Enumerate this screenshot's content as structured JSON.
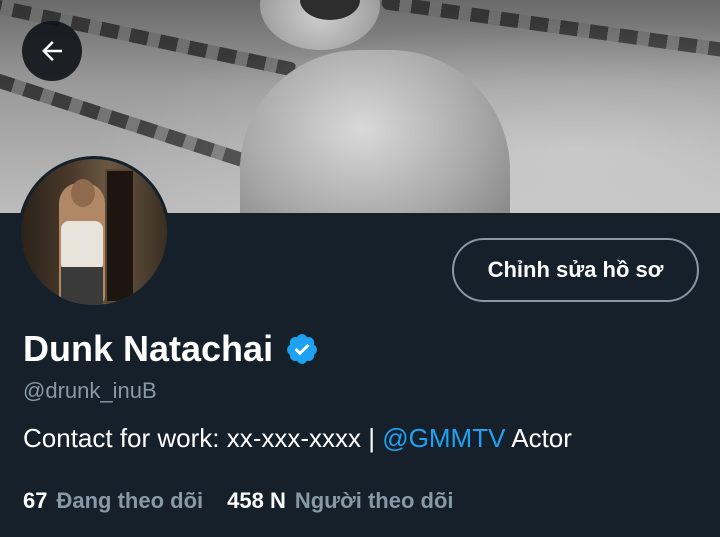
{
  "profile": {
    "name": "Dunk Natachai",
    "handle": "@drunk_inuB",
    "bio": {
      "prefix": "Contact for work: xx-xxx-xxxx | ",
      "link": "@GMMTV",
      "suffix": " Actor"
    },
    "edit_button_label": "Chỉnh sửa hồ sơ",
    "verified": true,
    "following": {
      "count": "67",
      "label": "Đang theo dõi"
    },
    "followers": {
      "count": "458 N",
      "label": "Người theo dõi"
    }
  },
  "icons": {
    "back": "arrow-left-icon",
    "verified": "verified-badge-icon"
  },
  "colors": {
    "background": "#15202b",
    "accent": "#1da1f2",
    "secondary_text": "#8899a6",
    "button_border": "#8a96a3"
  }
}
